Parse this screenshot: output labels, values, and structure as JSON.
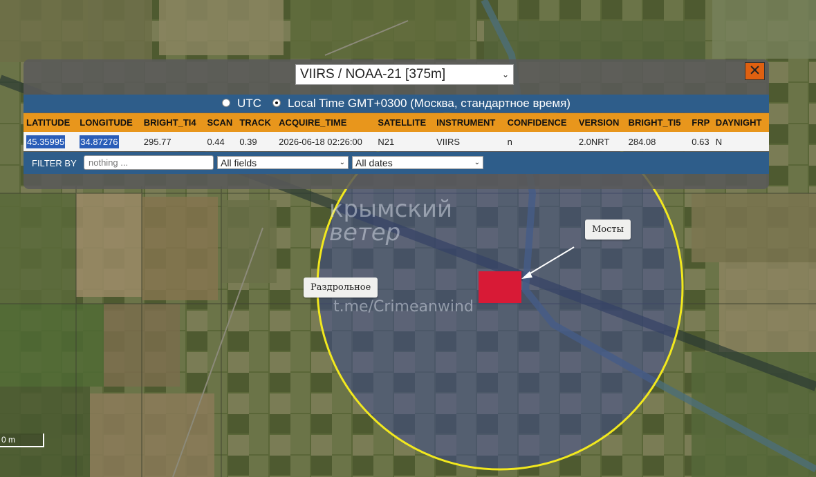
{
  "map": {
    "places": [
      {
        "label": "Раздрольное"
      },
      {
        "label": "Мосты"
      }
    ],
    "watermark": {
      "line1": "крымский",
      "line2": "ветер",
      "handle": "t.me/Crimeanwind"
    },
    "scale_label": "0 m",
    "colors": {
      "fire_pixel": "#d81a36",
      "radius_circle": "#f2e81e",
      "overlay": "#404c96"
    }
  },
  "panel": {
    "source_select": "VIIRS / NOAA-21 [375m]",
    "close_icon": "close-icon",
    "time_options": [
      {
        "label": "UTC",
        "checked": false
      },
      {
        "label": "Local Time GMT+0300 (Москва, стандартное время)",
        "checked": true
      }
    ],
    "table": {
      "columns": [
        "LATITUDE",
        "LONGITUDE",
        "BRIGHT_TI4",
        "SCAN",
        "TRACK",
        "ACQUIRE_TIME",
        "SATELLITE",
        "INSTRUMENT",
        "CONFIDENCE",
        "VERSION",
        "BRIGHT_TI5",
        "FRP",
        "DAYNIGHT"
      ],
      "rows": [
        [
          "45.35995",
          "34.87276",
          "295.77",
          "0.44",
          "0.39",
          "2026-06-18 02:26:00",
          "N21",
          "VIIRS",
          "n",
          "2.0NRT",
          "284.08",
          "0.63",
          "N"
        ]
      ]
    },
    "filter": {
      "label": "FILTER BY",
      "placeholder": "nothing ...",
      "fields_select": "All fields",
      "dates_select": "All dates"
    },
    "colors": {
      "header": "#e8961c",
      "bar": "#2e5d8a",
      "close": "#e06010"
    }
  }
}
